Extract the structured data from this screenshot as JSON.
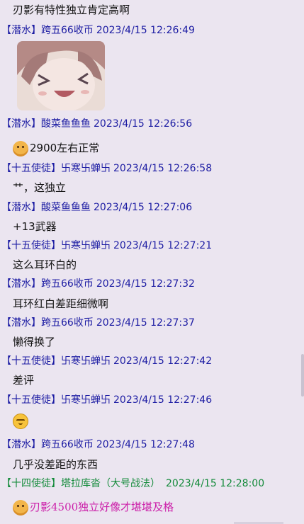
{
  "messages": [
    {
      "type": "text",
      "text": "刃影有特性独立肯定高啊"
    },
    {
      "type": "header",
      "tag": "【潜水】",
      "name": "跨五66收币",
      "time": "2023/4/15 12:26:49"
    },
    {
      "type": "image",
      "icon": "anime-girl-sticker"
    },
    {
      "type": "header",
      "tag": "【潜水】",
      "name": "酸菜鱼鱼鱼",
      "time": "2023/4/15 12:26:56"
    },
    {
      "type": "text",
      "emoji": "doge-emoji",
      "text": "2900左右正常"
    },
    {
      "type": "header",
      "tag": "【十五使徒】",
      "name": "卐寒卐蝉卐",
      "time": "2023/4/15 12:26:58"
    },
    {
      "type": "text",
      "text": "艹，这独立"
    },
    {
      "type": "header",
      "tag": "【潜水】",
      "name": "酸菜鱼鱼鱼",
      "time": "2023/4/15 12:27:06"
    },
    {
      "type": "text",
      "text": "+13武器"
    },
    {
      "type": "header",
      "tag": "【十五使徒】",
      "name": "卐寒卐蝉卐",
      "time": "2023/4/15 12:27:21"
    },
    {
      "type": "text",
      "text": "这么耳环白的"
    },
    {
      "type": "header",
      "tag": "【潜水】",
      "name": "跨五66收币",
      "time": "2023/4/15 12:27:32"
    },
    {
      "type": "text",
      "text": "耳环红白差距细微啊"
    },
    {
      "type": "header",
      "tag": "【潜水】",
      "name": "跨五66收币",
      "time": "2023/4/15 12:27:37"
    },
    {
      "type": "text",
      "text": "懒得换了"
    },
    {
      "type": "header",
      "tag": "【十五使徒】",
      "name": "卐寒卐蝉卐",
      "time": "2023/4/15 12:27:42"
    },
    {
      "type": "text",
      "text": "差评"
    },
    {
      "type": "header",
      "tag": "【十五使徒】",
      "name": "卐寒卐蝉卐",
      "time": "2023/4/15 12:27:46"
    },
    {
      "type": "emoji",
      "emoji": "smug-emoji"
    },
    {
      "type": "header",
      "tag": "【潜水】",
      "name": "跨五66收币",
      "time": "2023/4/15 12:27:48"
    },
    {
      "type": "text",
      "text": "几乎没差距的东西"
    },
    {
      "type": "header",
      "tag": "【十四使徒】",
      "name": "塔拉库沓（大号战法）",
      "time": "2023/4/15 12:28:00",
      "color": "green"
    },
    {
      "type": "text",
      "emoji": "doge-emoji",
      "text": "刃影4500独立好像才堪堪及格",
      "color": "pink"
    }
  ],
  "colors": {
    "background": "#ebe5f0",
    "header_blue": "#1c1ca3",
    "header_green": "#138a3a",
    "highlight_pink": "#cc22aa"
  }
}
